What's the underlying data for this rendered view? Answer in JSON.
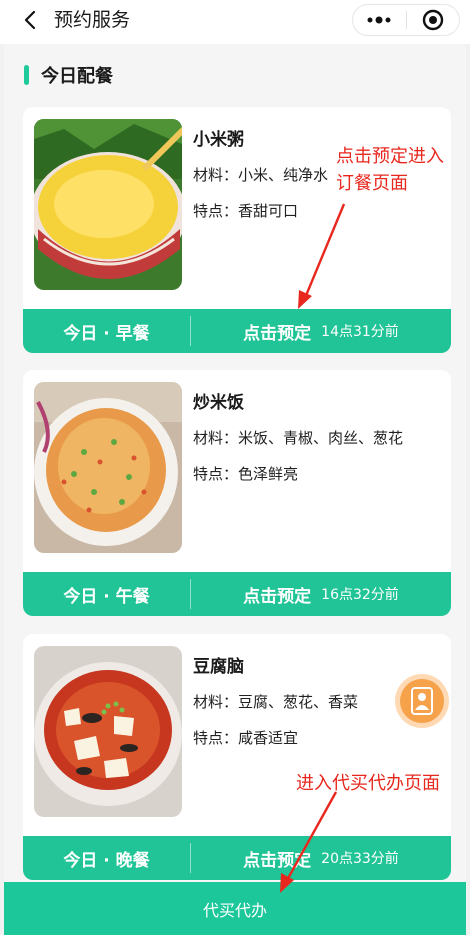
{
  "navbar": {
    "title": "预约服务",
    "back_icon": "chevron-left-icon",
    "more_icon": "more-dots-icon",
    "close_icon": "target-circle-icon"
  },
  "section": {
    "title": "今日配餐"
  },
  "meals": [
    {
      "name": "小米粥",
      "materials_label": "材料：",
      "materials": "小米、纯净水",
      "features_label": "特点：",
      "features": "香甜可口",
      "meal_label": "今日 · 早餐",
      "order_label": "点击预定",
      "deadline": "14点31分前",
      "image": "millet-porridge"
    },
    {
      "name": "炒米饭",
      "materials_label": "材料：",
      "materials": "米饭、青椒、肉丝、葱花",
      "features_label": "特点：",
      "features": "色泽鲜亮",
      "meal_label": "今日 · 午餐",
      "order_label": "点击预定",
      "deadline": "16点32分前",
      "image": "fried-rice"
    },
    {
      "name": "豆腐脑",
      "materials_label": "材料：",
      "materials": "豆腐、葱花、香菜",
      "features_label": "特点：",
      "features": "咸香适宜",
      "meal_label": "今日 · 晚餐",
      "order_label": "点击预定",
      "deadline": "20点33分前",
      "image": "tofu-pudding"
    }
  ],
  "floating_button": {
    "icon": "service-person-icon"
  },
  "bottom_bar": {
    "label": "代买代办"
  },
  "annotations": {
    "order_note_line1": "点击预定进入",
    "order_note_line2": "订餐页面",
    "proxy_note": "进入代买代办页面"
  },
  "colors": {
    "accent": "#21c496",
    "annotation": "#e8281e",
    "floating": "#f5a24a"
  }
}
